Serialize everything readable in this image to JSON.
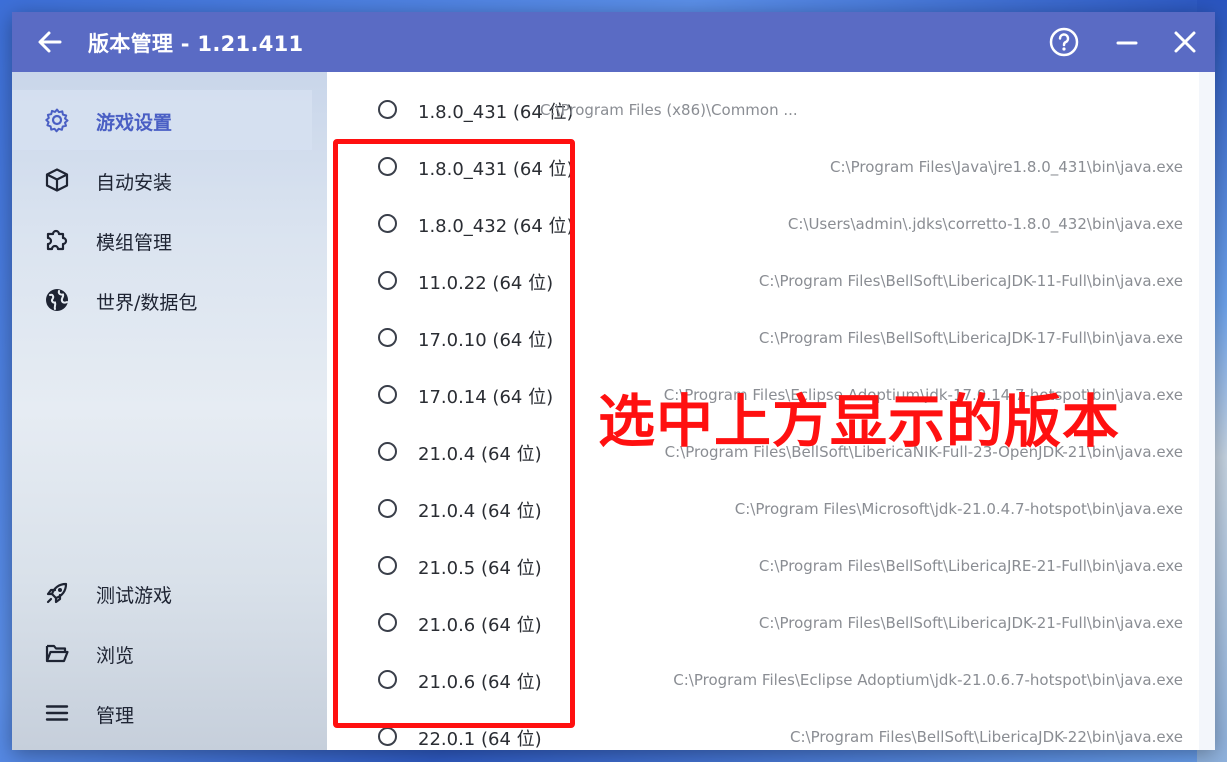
{
  "window": {
    "title": "版本管理 - 1.21.411"
  },
  "icons": {
    "back": "arrow-left-icon",
    "help": "help-circle-icon",
    "minimize": "minimize-icon",
    "close": "close-icon"
  },
  "colors": {
    "titlebar": "#5a6bc4",
    "accent": "#4a5fc4",
    "highlight": "#ff1010"
  },
  "sidebar": {
    "items": [
      {
        "label": "游戏设置",
        "icon": "gear-icon",
        "active": true
      },
      {
        "label": "自动安装",
        "icon": "cube-icon",
        "active": false
      },
      {
        "label": "模组管理",
        "icon": "puzzle-icon",
        "active": false
      },
      {
        "label": "世界/数据包",
        "icon": "globe-icon",
        "active": false
      }
    ],
    "bottom_items": [
      {
        "label": "测试游戏",
        "icon": "rocket-icon"
      },
      {
        "label": "浏览",
        "icon": "folder-icon"
      },
      {
        "label": "管理",
        "icon": "menu-icon"
      }
    ]
  },
  "java_list": [
    {
      "version": "1.8.0_431 (64 位)",
      "path": "C:\\Program Files (x86)\\Common ..."
    },
    {
      "version": "1.8.0_431 (64 位)",
      "path": "C:\\Program Files\\Java\\jre1.8.0_431\\bin\\java.exe"
    },
    {
      "version": "1.8.0_432 (64 位)",
      "path": "C:\\Users\\admin\\.jdks\\corretto-1.8.0_432\\bin\\java.exe"
    },
    {
      "version": "11.0.22 (64 位)",
      "path": "C:\\Program Files\\BellSoft\\LibericaJDK-11-Full\\bin\\java.exe"
    },
    {
      "version": "17.0.10 (64 位)",
      "path": "C:\\Program Files\\BellSoft\\LibericaJDK-17-Full\\bin\\java.exe"
    },
    {
      "version": "17.0.14 (64 位)",
      "path": "C:\\Program Files\\Eclipse Adoptium\\jdk-17.0.14.7-hotspot\\bin\\java.exe"
    },
    {
      "version": "21.0.4 (64 位)",
      "path": "C:\\Program Files\\BellSoft\\LibericaNIK-Full-23-OpenJDK-21\\bin\\java.exe"
    },
    {
      "version": "21.0.4 (64 位)",
      "path": "C:\\Program Files\\Microsoft\\jdk-21.0.4.7-hotspot\\bin\\java.exe"
    },
    {
      "version": "21.0.5 (64 位)",
      "path": "C:\\Program Files\\BellSoft\\LibericaJRE-21-Full\\bin\\java.exe"
    },
    {
      "version": "21.0.6 (64 位)",
      "path": "C:\\Program Files\\BellSoft\\LibericaJDK-21-Full\\bin\\java.exe"
    },
    {
      "version": "21.0.6 (64 位)",
      "path": "C:\\Program Files\\Eclipse Adoptium\\jdk-21.0.6.7-hotspot\\bin\\java.exe"
    },
    {
      "version": "22.0.1 (64 位)",
      "path": "C:\\Program Files\\BellSoft\\LibericaJDK-22\\bin\\java.exe"
    }
  ],
  "annotation": {
    "text": "选中上方显示的版本"
  }
}
